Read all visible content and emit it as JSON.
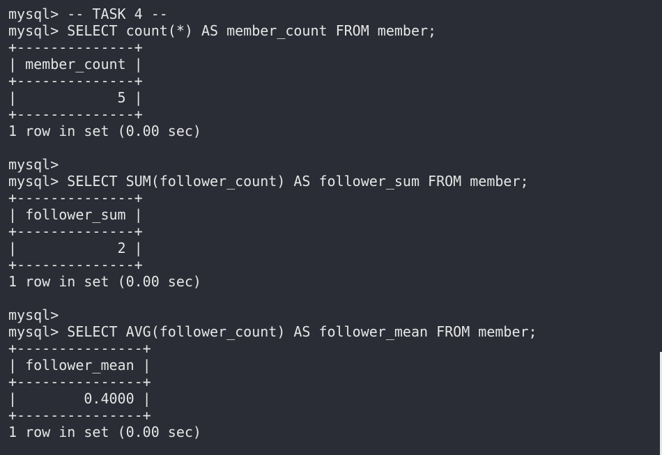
{
  "terminal": {
    "lines": [
      "mysql> -- TASK 4 --",
      "mysql> SELECT count(*) AS member_count FROM member;",
      "+--------------+",
      "| member_count |",
      "+--------------+",
      "|            5 |",
      "+--------------+",
      "1 row in set (0.00 sec)",
      "",
      "mysql>",
      "mysql> SELECT SUM(follower_count) AS follower_sum FROM member;",
      "+--------------+",
      "| follower_sum |",
      "+--------------+",
      "|            2 |",
      "+--------------+",
      "1 row in set (0.00 sec)",
      "",
      "mysql>",
      "mysql> SELECT AVG(follower_count) AS follower_mean FROM member;",
      "+---------------+",
      "| follower_mean |",
      "+---------------+",
      "|        0.4000 |",
      "+---------------+",
      "1 row in set (0.00 sec)"
    ]
  },
  "colors": {
    "background": "#2a2d35",
    "text": "#e6e6e6"
  }
}
